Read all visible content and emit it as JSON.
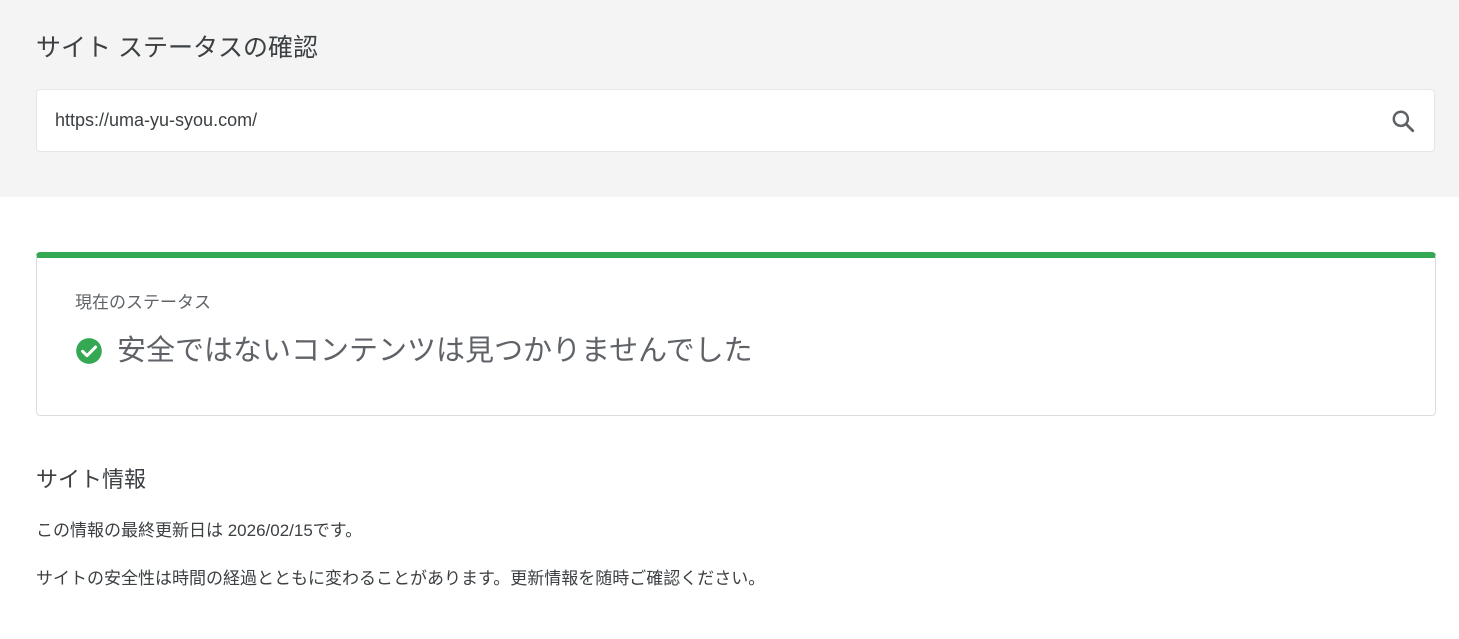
{
  "header": {
    "title": "サイト ステータスの確認"
  },
  "search": {
    "value": "https://uma-yu-syou.com/",
    "icon": "search-icon"
  },
  "status": {
    "label": "現在のステータス",
    "message": "安全ではないコンテンツは見つかりませんでした",
    "icon": "check-circle-icon",
    "accent_color": "#34a853"
  },
  "site_info": {
    "title": "サイト情報",
    "last_updated": "この情報の最終更新日は 2026/02/15です。",
    "note": "サイトの安全性は時間の経過とともに変わることがあります。更新情報を随時ご確認ください。"
  }
}
